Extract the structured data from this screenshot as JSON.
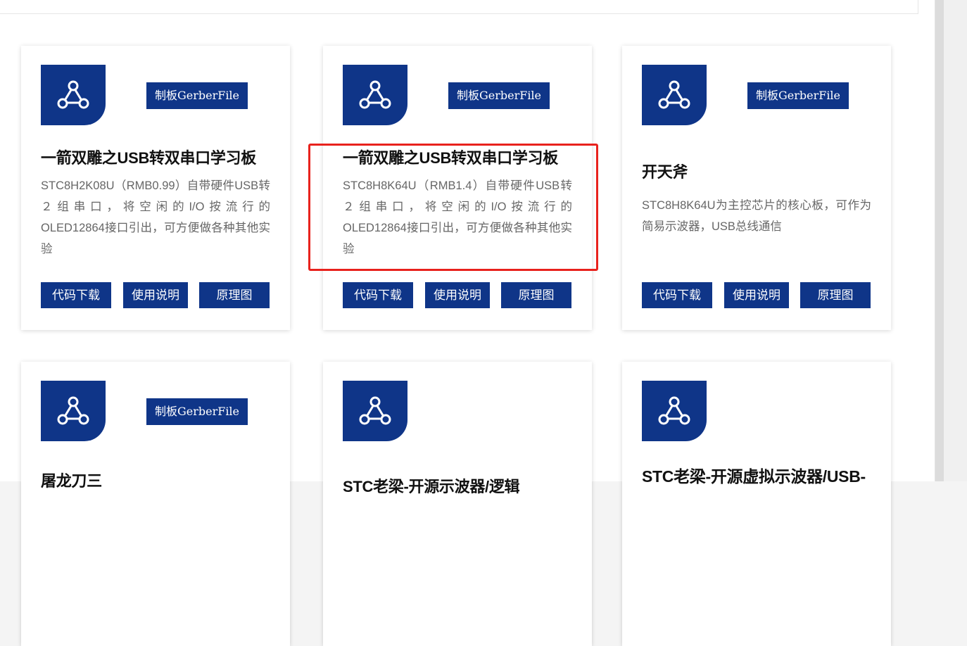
{
  "cards": [
    {
      "logo_icon": "share-nodes-icon",
      "gerber": "制板GerberFile",
      "title": "一箭双雕之USB转双串口学习板",
      "desc": "STC8H2K08U（RMB0.99）自带硬件USB转２组串口，将空闲的I/O按流行的 OLED12864接口引出，可方便做各种其他实验",
      "buttons": [
        "代码下载",
        "使用说明",
        "原理图"
      ]
    },
    {
      "logo_icon": "share-nodes-icon",
      "gerber": "制板GerberFile",
      "title": "一箭双雕之USB转双串口学习板",
      "desc": "STC8H8K64U（RMB1.4）自带硬件USB转２组串口，将空闲的I/O按流行的 OLED12864接口引出，可方便做各种其他实验",
      "buttons": [
        "代码下载",
        "使用说明",
        "原理图"
      ]
    },
    {
      "logo_icon": "share-nodes-icon",
      "gerber": "制板GerberFile",
      "title": "开天斧",
      "desc": "STC8H8K64U为主控芯片的核心板，可作为简易示波器，USB总线通信",
      "buttons": [
        "代码下载",
        "使用说明",
        "原理图"
      ]
    },
    {
      "logo_icon": "share-nodes-icon",
      "gerber": "制板GerberFile",
      "title": "屠龙刀三"
    },
    {
      "logo_icon": "share-nodes-icon",
      "title": "STC老梁-开源示波器/逻辑"
    },
    {
      "logo_icon": "share-nodes-icon",
      "title": "STC老梁-开源虚拟示波器/USB-"
    }
  ],
  "colors": {
    "brand": "#0f3588",
    "highlight": "#e8221d"
  }
}
